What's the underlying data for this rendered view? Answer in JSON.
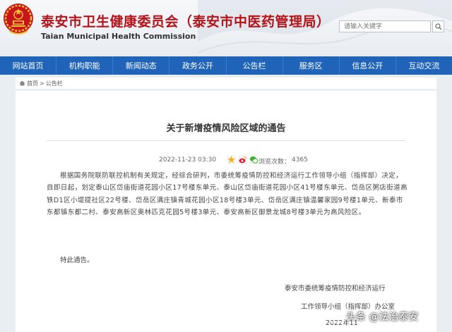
{
  "header": {
    "title_cn": "泰安市卫生健康委员会（泰安市中医药管理局）",
    "title_en": "Taian Municipal Health Commission",
    "search_placeholder": "请输入关键字"
  },
  "nav": {
    "items": [
      "网站首页",
      "机构职能",
      "新闻动态",
      "政务公开",
      "公告栏",
      "服务区",
      "信息公开",
      "互动交流"
    ]
  },
  "breadcrumb": {
    "home": "首页",
    "separator": ">",
    "current": "公告栏"
  },
  "article": {
    "title": "关于新增疫情风险区域的通告",
    "date": "2022-11-23 03:30",
    "views_label": "浏览次数：",
    "views": "4365",
    "body": "根据国务院联防联控机制有关规定，经综合研判，市委统筹疫情防控和经济运行工作领导小组（指挥部）决定，自即日起，划定泰山区岱庙街道花园小区17号楼东单元、泰山区岱庙街道花园小区41号楼东单元、岱岳区粥店街道高铁D1区小堤提社区22号楼、岱岳区满庄镇青城花园小区18号楼3单元、岱岳区满庄镇温馨家园9号楼1单元、新泰市东都镇东都二村、泰安高新区奥林匹克花园5号楼3单元、泰安高新区御景龙城8号楼3单元为高风险区。",
    "closing": "特此通告。",
    "signature_line1": "泰安市委统筹疫情防控和经济运行",
    "signature_line2": "工作领导小组（指挥部）办公室",
    "signature_date": "2022年11"
  },
  "watermark": {
    "text": "头条 @法治泰安"
  },
  "colors": {
    "brand_red": "#b3141a",
    "nav_blue": "#1f64b8",
    "page_bg": "#e9eef3"
  },
  "icons": {
    "search": "search-icon",
    "home": "home-icon",
    "share_qzone": "qzone-star-icon",
    "share_weibo": "weibo-icon",
    "share_wechat": "wechat-icon",
    "emblem": "national-emblem-icon"
  }
}
